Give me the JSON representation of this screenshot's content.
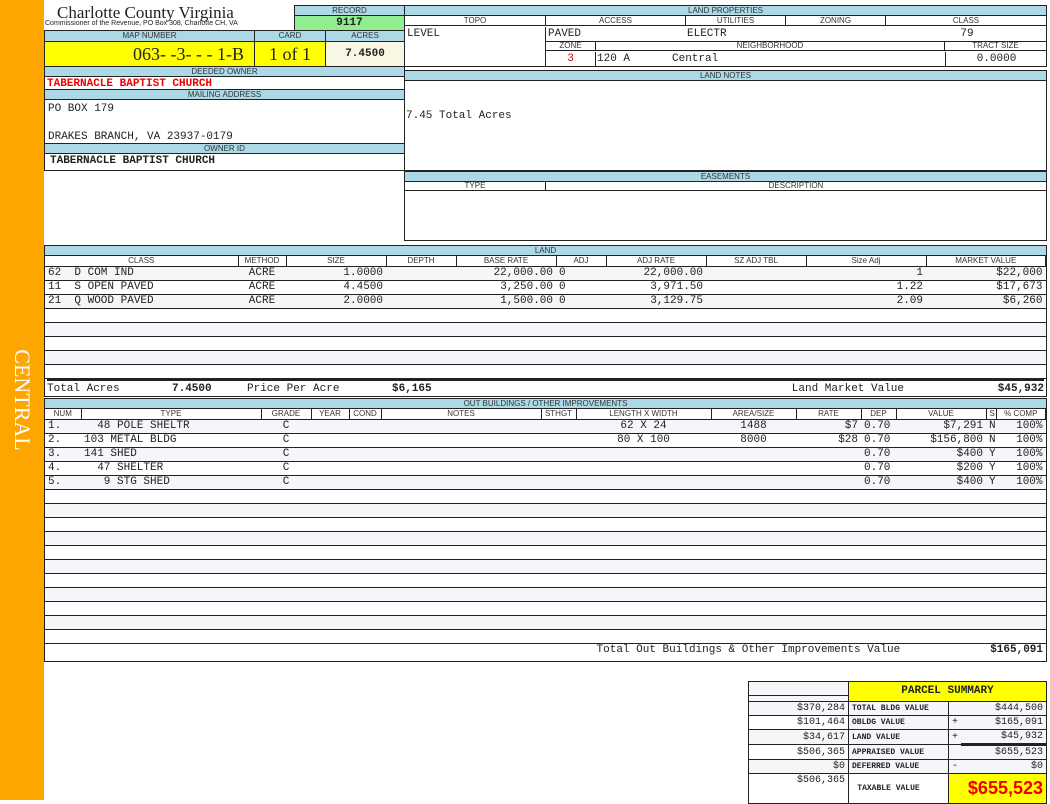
{
  "sidebar": {
    "label": "CENTRAL",
    "color": "#ffa500"
  },
  "header": {
    "title": "Charlotte County Virginia",
    "subtitle": "Commissioner of the Revenue, PO Box 308, Charlotte CH, VA"
  },
  "record": {
    "label": "RECORD",
    "value": "9117"
  },
  "parcel": {
    "map_label": "MAP NUMBER",
    "map_number": "063- -3- - - 1-B",
    "card_label": "CARD",
    "card": "1 of 1",
    "acres_label": "ACRES",
    "acres": "7.4500"
  },
  "owner": {
    "deeded_label": "DEEDED OWNER",
    "deeded": "TABERNACLE BAPTIST CHURCH",
    "mailing_label": "MAILING ADDRESS",
    "address1": "PO BOX 179",
    "address2": "DRAKES BRANCH, VA 23937-0179",
    "id_label": "OWNER ID",
    "id": "TABERNACLE BAPTIST CHURCH"
  },
  "land_properties": {
    "title": "LAND PROPERTIES",
    "topo_label": "TOPO",
    "topo": "LEVEL",
    "access_label": "ACCESS",
    "access": "PAVED",
    "utilities_label": "UTILITIES",
    "utilities": "ELECTR",
    "zoning_label": "ZONING",
    "zoning": "",
    "class_label": "CLASS",
    "class": "79",
    "zone_label": "ZONE",
    "zone": "3",
    "neighborhood_label": "NEIGHBORHOOD",
    "neighborhood_code": "120 A",
    "neighborhood": "Central",
    "tract_label": "TRACT SIZE",
    "tract": "0.0000"
  },
  "land_notes": {
    "title": "LAND NOTES",
    "text": "7.45 Total Acres"
  },
  "easements": {
    "title": "EASEMENTS",
    "type_label": "TYPE",
    "description_label": "DESCRIPTION"
  },
  "land": {
    "title": "LAND",
    "columns": [
      "CLASS",
      "METHOD",
      "SIZE",
      "DEPTH",
      "BASE RATE",
      "ADJ",
      "ADJ RATE",
      "SZ ADJ TBL",
      "Size Adj",
      "MARKET VALUE"
    ],
    "rows": [
      [
        "62  D COM IND",
        "ACRE",
        "1.0000",
        "",
        "22,000.00",
        "0",
        "22,000.00",
        "",
        "1",
        "$22,000"
      ],
      [
        "11  S OPEN PAVED",
        "ACRE",
        "4.4500",
        "",
        "3,250.00",
        "0",
        "3,971.50",
        "",
        "1.22",
        "$17,673"
      ],
      [
        "21  Q WOOD PAVED",
        "ACRE",
        "2.0000",
        "",
        "1,500.00",
        "0",
        "3,129.75",
        "",
        "2.09",
        "$6,260"
      ]
    ],
    "total_acres_label": "Total Acres",
    "total_acres": "7.4500",
    "ppa_label": "Price Per Acre",
    "ppa": "$6,165",
    "market_label": "Land Market Value",
    "market": "$45,932"
  },
  "outbuildings": {
    "title": "OUT BUILDINGS / OTHER IMPROVEMENTS",
    "columns": [
      "NUM",
      "TYPE",
      "GRADE",
      "YEAR",
      "COND",
      "NOTES",
      "STHGT",
      "LENGTH X WIDTH",
      "AREA/SIZE",
      "RATE",
      "DEP",
      "VALUE",
      "S",
      "% COMP"
    ],
    "rows": [
      [
        "1.",
        "  48 POLE SHELTR",
        "C",
        "",
        "",
        "",
        "",
        "62 X 24",
        "1488",
        "$7",
        "0.70",
        "$7,291",
        "N",
        "100%"
      ],
      [
        "2.",
        "103 METAL BLDG",
        "C",
        "",
        "",
        "",
        "",
        "80 X 100",
        "8000",
        "$28",
        "0.70",
        "$156,800",
        "N",
        "100%"
      ],
      [
        "3.",
        "141 SHED",
        "C",
        "",
        "",
        "",
        "",
        "",
        "",
        "",
        "0.70",
        "$400",
        "Y",
        "100%"
      ],
      [
        "4.",
        "  47 SHELTER",
        "C",
        "",
        "",
        "",
        "",
        "",
        "",
        "",
        "0.70",
        "$200",
        "Y",
        "100%"
      ],
      [
        "5.",
        "   9 STG SHED",
        "C",
        "",
        "",
        "",
        "",
        "",
        "",
        "",
        "0.70",
        "$400",
        "Y",
        "100%"
      ]
    ],
    "total_label": "Total Out Buildings & Other Improvements Value",
    "total": "$165,091"
  },
  "summary": {
    "title": "PARCEL SUMMARY",
    "rows": [
      {
        "prior": "$370,284",
        "label": "TOTAL BLDG VALUE",
        "op": "",
        "value": "$444,500"
      },
      {
        "prior": "$101,464",
        "label": "OBLDG VALUE",
        "op": "+",
        "value": "$165,091"
      },
      {
        "prior": "$34,617",
        "label": "LAND VALUE",
        "op": "+",
        "value": "$45,932"
      },
      {
        "prior": "$506,365",
        "label": "APPRAISED VALUE",
        "op": "",
        "value": "$655,523"
      },
      {
        "prior": "$0",
        "label": "DEFERRED VALUE",
        "op": "-",
        "value": "$0"
      }
    ],
    "taxable_prior": "$506,365",
    "taxable_label": "TAXABLE VALUE",
    "taxable": "$655,523"
  }
}
